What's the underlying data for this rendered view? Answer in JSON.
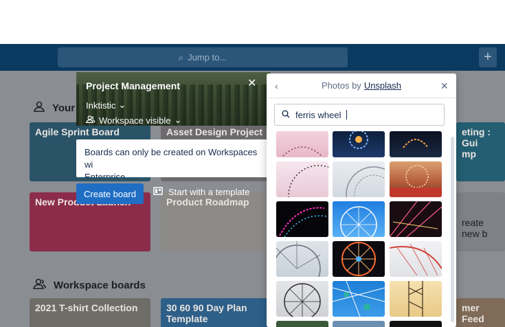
{
  "topbar": {
    "search_placeholder": "Jump to...",
    "plus_label": "+"
  },
  "sections": {
    "your_boards": "Your",
    "workspace_boards": "Workspace boards"
  },
  "tiles": {
    "agile": "Agile Sprint Board",
    "asset": "Asset Design Project",
    "new_product": "New Product Launch",
    "roadmap": "Product Roadmap",
    "meeting": "eting : Gui\nmp",
    "create_new": "reate new b",
    "tshirt": "2021 T-shirt Collection",
    "plan": "30 60 90 Day Plan Template",
    "feedback": "mer Feed\nam"
  },
  "create_board": {
    "title": "Project Management",
    "workspace": "Inktistic",
    "visibility": "Workspace visible",
    "warning": "Boards can only be created on Workspaces wi\nEnterprise.",
    "create_label": "Create board",
    "template_label": "Start with a template"
  },
  "photos": {
    "header_prefix": "Photos by",
    "header_link": "Unsplash",
    "search_value": "ferris wheel"
  },
  "colors": {
    "topbar": "#0b3a61",
    "accent": "#1f6ec4"
  }
}
